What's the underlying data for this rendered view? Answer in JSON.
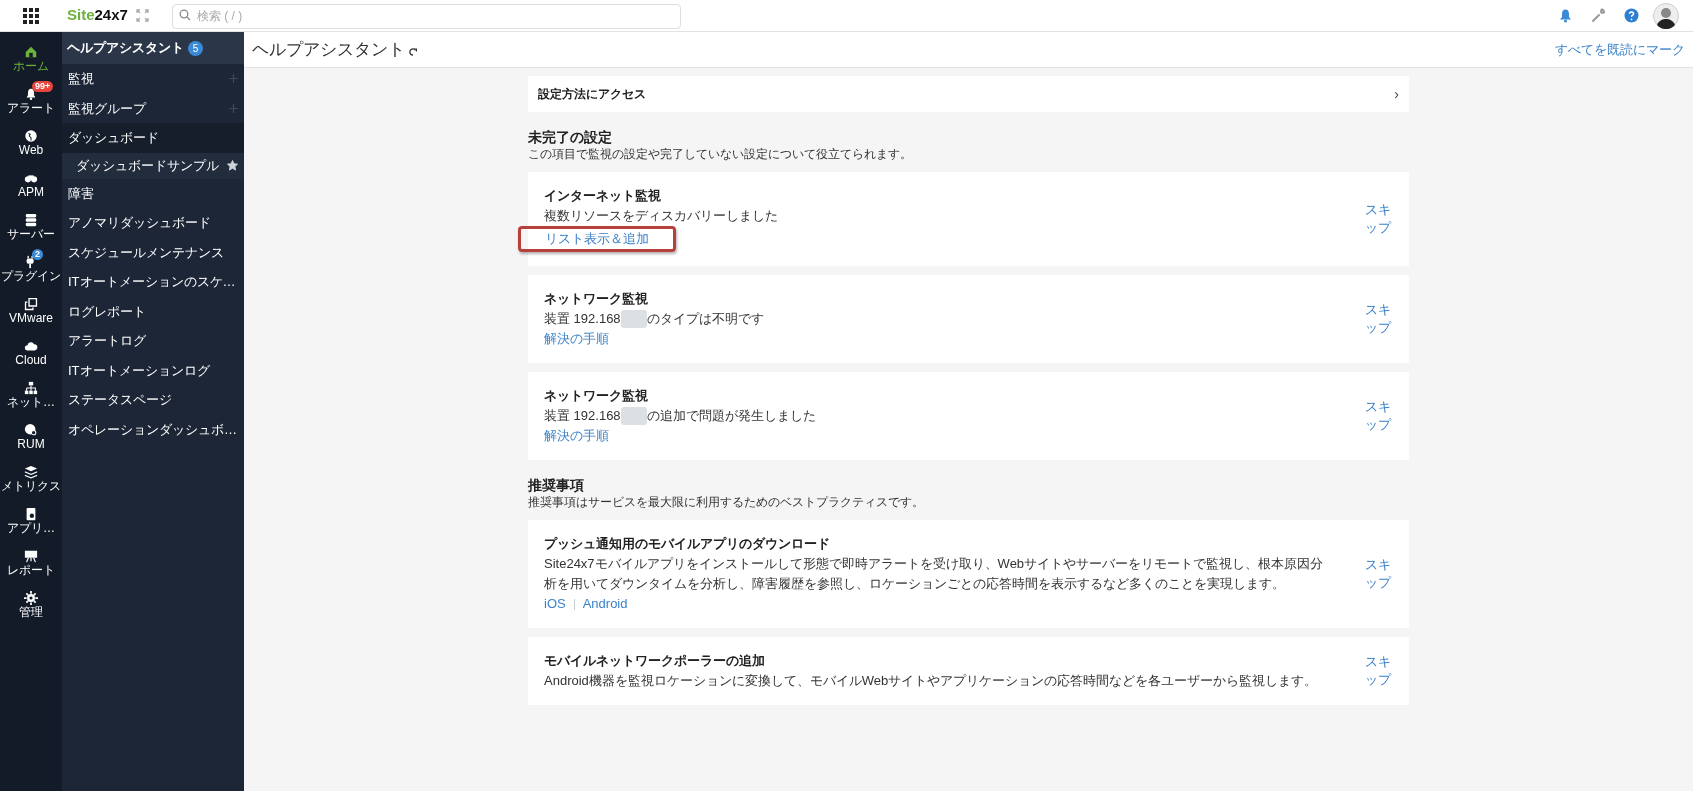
{
  "topbar": {
    "logo": {
      "first": "Site",
      "second": "24x7"
    },
    "search": {
      "placeholder": "検索 ( / )"
    }
  },
  "rail": [
    {
      "label": "ホーム",
      "selected": true
    },
    {
      "label": "アラート",
      "selected": false,
      "badge": "99+",
      "color": "#e8453c"
    },
    {
      "label": "Web",
      "selected": false
    },
    {
      "label": "APM",
      "selected": false
    },
    {
      "label": "サーバー",
      "selected": false
    },
    {
      "label": "プラグイン",
      "selected": false,
      "badge": "2",
      "color": "#3b8ad8"
    },
    {
      "label": "VMware",
      "selected": false
    },
    {
      "label": "Cloud",
      "selected": false
    },
    {
      "label": "ネット…",
      "selected": false
    },
    {
      "label": "RUM",
      "selected": false
    },
    {
      "label": "メトリクス",
      "selected": false
    },
    {
      "label": "アプリ…",
      "selected": false
    },
    {
      "label": "レポート",
      "selected": false
    },
    {
      "label": "管理",
      "selected": false
    }
  ],
  "sidebar": {
    "title": "ヘルプアシスタント",
    "count": "5",
    "items": [
      {
        "label": "監視",
        "add_button": true
      },
      {
        "label": "監視グループ",
        "add_button": true
      },
      {
        "label": "ダッシュボード",
        "add_button": false,
        "expanded": true,
        "children": [
          {
            "label": "ダッシュボードサンプル",
            "starred": true
          }
        ]
      },
      {
        "label": "障害",
        "add_button": false
      },
      {
        "label": "アノマリダッシュボード",
        "add_button": false
      },
      {
        "label": "スケジュールメンテナンス",
        "add_button": false
      },
      {
        "label": "ITオートメーションのスケ…",
        "add_button": false
      },
      {
        "label": "ログレポート",
        "add_button": false
      },
      {
        "label": "アラートログ",
        "add_button": false
      },
      {
        "label": "ITオートメーションログ",
        "add_button": false
      },
      {
        "label": "ステータスページ",
        "add_button": false
      },
      {
        "label": "オペレーションダッシュボ…",
        "add_button": false
      }
    ]
  },
  "header": {
    "title": "ヘルプアシスタント",
    "mark_all_read": "すべてを既読にマーク"
  },
  "access_card": {
    "label": "設定方法にアクセス",
    "chevron": "›"
  },
  "sections": [
    {
      "title": "未完了の設定",
      "description": "この項目で監視の設定や完了していない設定について役立てられます。",
      "cards": [
        {
          "title": "インターネット監視",
          "lines": [
            {
              "text": "複数リソースをディスカバリーしました"
            }
          ],
          "links": [
            {
              "label": "リスト表示＆追加",
              "highlighted": true
            }
          ],
          "skip": "スキップ"
        },
        {
          "title": "ネットワーク監視",
          "lines": [
            {
              "text": "装置 192.168",
              "redacted": true,
              "after": "のタイプは不明です"
            }
          ],
          "links": [
            {
              "label": "解決の手順",
              "highlighted": false
            }
          ],
          "skip": "スキップ"
        },
        {
          "title": "ネットワーク監視",
          "lines": [
            {
              "text": "装置 192.168",
              "redacted": true,
              "after": "の追加で問題が発生しました"
            }
          ],
          "links": [
            {
              "label": "解決の手順",
              "highlighted": false
            }
          ],
          "skip": "スキップ"
        }
      ]
    },
    {
      "title": "推奨事項",
      "description": "推奨事項はサービスを最大限に利用するためのベストプラクティスです。",
      "cards": [
        {
          "title": "プッシュ通知用のモバイルアプリのダウンロード",
          "lines": [
            {
              "text": "Site24x7モバイルアプリをインストールして形態で即時アラートを受け取り、Webサイトやサーバーをリモートで監視し、根本原因分析を用いてダウンタイムを分析し、障害履歴を参照し、ロケーションごとの応答時間を表示するなど多くのことを実現します。"
            }
          ],
          "links": [
            {
              "label": "iOS",
              "highlighted": false
            },
            {
              "label": "Android",
              "highlighted": false
            }
          ],
          "skip": "スキップ"
        },
        {
          "title": "モバイルネットワークポーラーの追加",
          "lines": [
            {
              "text": "Android機器を監視ロケーションに変換して、モバイルWebサイトやアプリケーションの応答時間などを各ユーザーから監視します。"
            }
          ],
          "skip": "スキップ"
        }
      ]
    }
  ]
}
